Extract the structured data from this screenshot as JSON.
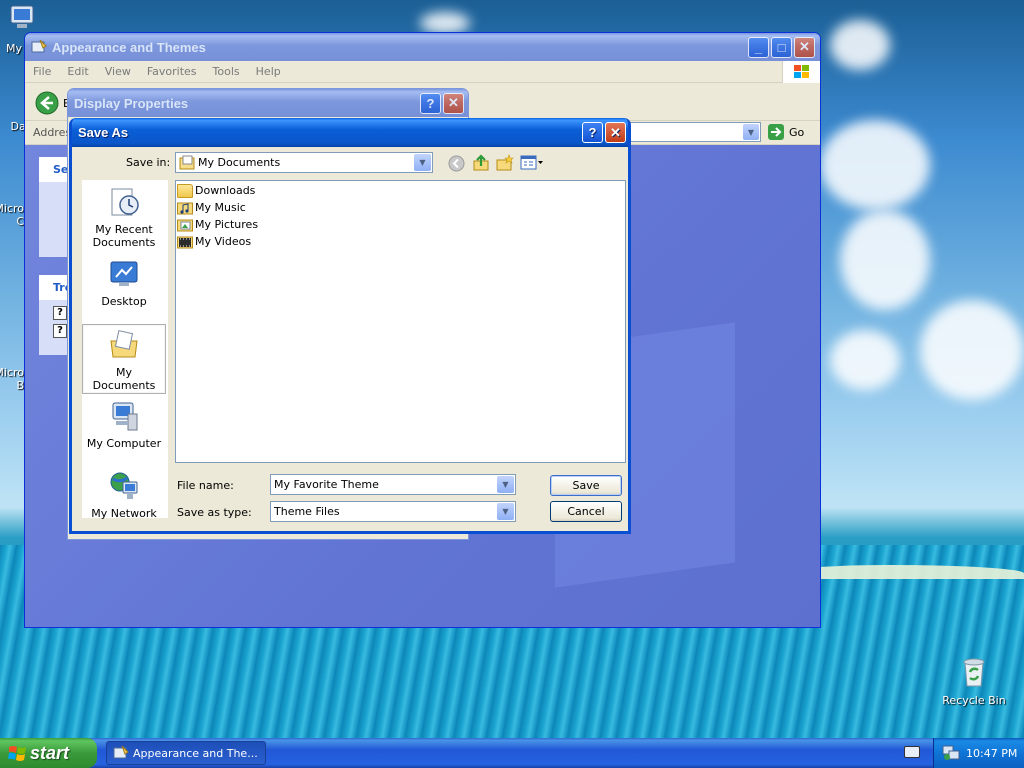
{
  "desktop": {
    "icons": [
      {
        "label": "My",
        "name": "desktop-icon-my-computer"
      },
      {
        "label": "Dat",
        "name": "desktop-icon-dat"
      },
      {
        "label": "Micro",
        "name": "desktop-icon-micro-1"
      },
      {
        "label": "C",
        "name": "desktop-icon-micro-1-sub"
      },
      {
        "label": "Micro",
        "name": "desktop-icon-micro-2"
      },
      {
        "label": "B",
        "name": "desktop-icon-micro-2-sub"
      }
    ],
    "recycle_bin": "Recycle Bin"
  },
  "explorer_window": {
    "title": "Appearance and Themes",
    "menu": [
      "File",
      "Edit",
      "View",
      "Favorites",
      "Tools",
      "Help"
    ],
    "back_label": "B",
    "address_label": "Addres",
    "go_label": "Go",
    "side_panel": {
      "see_also_title": "Se",
      "troubleshooters_title": "Tro",
      "help_glyph": "?"
    }
  },
  "display_properties": {
    "title": "Display Properties",
    "help_btn": "?",
    "close_btn": "✕"
  },
  "save_as": {
    "title": "Save As",
    "help_btn": "?",
    "close_btn": "✕",
    "save_in_label": "Save in:",
    "save_in_value": "My Documents",
    "places": [
      {
        "label": "My Recent Documents",
        "selected": false
      },
      {
        "label": "Desktop",
        "selected": false
      },
      {
        "label": "My Documents",
        "selected": true
      },
      {
        "label": "My Computer",
        "selected": false
      },
      {
        "label": "My Network",
        "selected": false
      }
    ],
    "files": [
      "Downloads",
      "My Music",
      "My Pictures",
      "My Videos"
    ],
    "file_name_label": "File name:",
    "file_name_value": "My Favorite Theme",
    "save_type_label": "Save as type:",
    "save_type_value": "Theme Files",
    "save_button": "Save",
    "cancel_button": "Cancel"
  },
  "taskbar": {
    "start_label": "start",
    "task_label": "Appearance and The...",
    "clock": "10:47 PM"
  },
  "colors": {
    "title_active": "#0a5fd6",
    "title_inactive": "#7d97dc",
    "explorer_body": "#6375d6",
    "dialog_body": "#ece9d8"
  }
}
